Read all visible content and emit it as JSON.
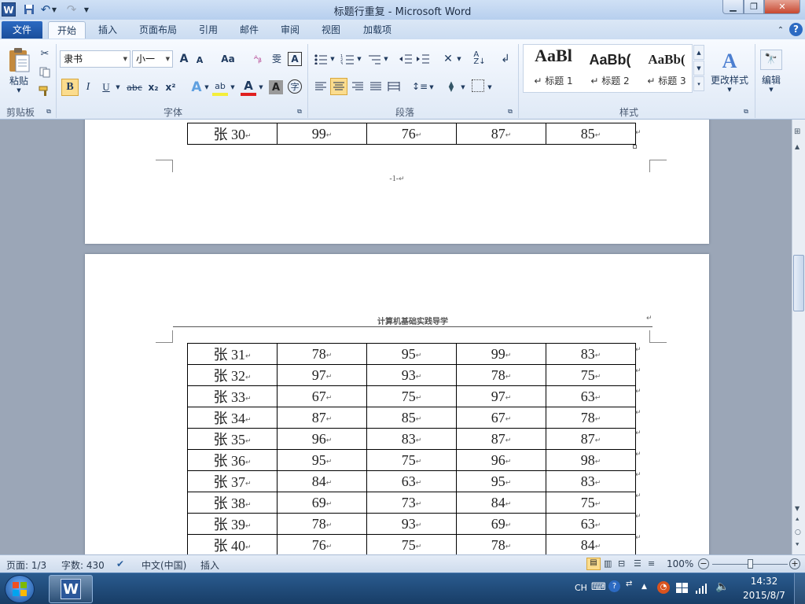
{
  "window": {
    "title": "标题行重复 - Microsoft Word",
    "app_icon": "W"
  },
  "qat": {
    "save": "save-icon",
    "undo": "undo-icon",
    "redo": "redo-icon"
  },
  "tabs": [
    "文件",
    "开始",
    "插入",
    "页面布局",
    "引用",
    "邮件",
    "审阅",
    "视图",
    "加载项"
  ],
  "ribbon": {
    "clipboard": {
      "paste": "粘贴",
      "group": "剪贴板"
    },
    "font": {
      "name": "隶书",
      "size": "小一",
      "group": "字体",
      "bold": "B",
      "italic": "I",
      "underline": "U",
      "strike": "abc",
      "sub": "x₂",
      "sup": "x²",
      "grow": "A",
      "shrink": "A",
      "case": "Aa",
      "charborder": "A",
      "charshade": "A"
    },
    "paragraph": {
      "group": "段落"
    },
    "styles": {
      "group": "样式",
      "items": [
        {
          "preview": "AaBl",
          "name": "标题 1"
        },
        {
          "preview": "AaBb(",
          "name": "标题 2"
        },
        {
          "preview": "AaBb(",
          "name": "标题 3"
        }
      ],
      "change": "更改样式"
    },
    "editing": {
      "label": "编辑"
    }
  },
  "document": {
    "page1": {
      "rows": [
        [
          "张 30",
          "99",
          "76",
          "87",
          "85"
        ]
      ],
      "footer": "-1-"
    },
    "page2": {
      "header": "计算机基础实践导学",
      "rows": [
        [
          "张 31",
          "78",
          "95",
          "99",
          "83"
        ],
        [
          "张 32",
          "97",
          "93",
          "78",
          "75"
        ],
        [
          "张 33",
          "67",
          "75",
          "97",
          "63"
        ],
        [
          "张 34",
          "87",
          "85",
          "67",
          "78"
        ],
        [
          "张 35",
          "96",
          "83",
          "87",
          "87"
        ],
        [
          "张 36",
          "95",
          "75",
          "96",
          "98"
        ],
        [
          "张 37",
          "84",
          "63",
          "95",
          "83"
        ],
        [
          "张 38",
          "69",
          "73",
          "84",
          "75"
        ],
        [
          "张 39",
          "78",
          "93",
          "69",
          "63"
        ],
        [
          "张 40",
          "76",
          "75",
          "78",
          "84"
        ]
      ]
    }
  },
  "status": {
    "page": "页面: 1/3",
    "words": "字数: 430",
    "lang": "中文(中国)",
    "mode": "插入",
    "zoom": "100%"
  },
  "taskbar": {
    "ime": "CH",
    "time": "14:32",
    "date": "2015/8/7"
  }
}
